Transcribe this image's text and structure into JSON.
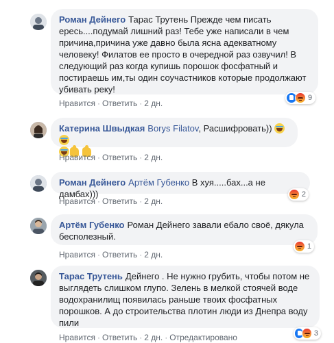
{
  "colors": {
    "bubble_bg": "#f2f3f5",
    "author": "#385898",
    "meta": "#606770",
    "like": "#1877f2",
    "angry": "#e9332b"
  },
  "comments": [
    {
      "author": "Роман Дейнего",
      "body_lines": [
        "Тарас Трутень Прежде чем писать",
        "ересь....подумай лишний раз! Тебе уже написали в чем",
        "причина,причина уже давно была ясна адекватному",
        "человеку! Филатов ее просто в очередной раз озвучил! В",
        "следующий раз когда купишь порошок фосфатный и",
        "постираешь им,ты один соучастников которые продолжают",
        "убивать реку!"
      ],
      "like_label": "Нравится",
      "reply_label": "Ответить",
      "time": "2 дн.",
      "reactions": [
        "like-icon",
        "angry-icon"
      ],
      "reaction_count": "9"
    },
    {
      "author": "Катерина Швыдкая",
      "mention": "Borys Filatov",
      "text": ", Расшифровать))",
      "emoji_line1": [
        "laughing-emoji",
        "laughing-emoji"
      ],
      "emoji_line2": [
        "laughing-emoji",
        "thumbs-up-emoji",
        "thumbs-up-emoji"
      ],
      "like_label": "Нравится",
      "reply_label": "Ответить",
      "time": "2 дн."
    },
    {
      "author": "Роман Дейнего",
      "mention": "Артём Губенко",
      "text": "В хуя.....бах...а не дамбах)))",
      "like_label": "Нравится",
      "reply_label": "Ответить",
      "time": "2 дн.",
      "reactions": [
        "angry-icon"
      ],
      "reaction_count": "2"
    },
    {
      "author": "Артём Губенко",
      "body_lines": [
        "Роман Дейнего завали ебало своё, дякула",
        "бесполезный."
      ],
      "like_label": "Нравится",
      "reply_label": "Ответить",
      "time": "2 дн.",
      "reactions": [
        "angry-icon"
      ],
      "reaction_count": "1"
    },
    {
      "author": "Тарас Трутень",
      "body_lines": [
        "Дейнего . Не нужно грубить, чтобы потом не",
        "выглядеть слишком глупо. Зелень в мелкой стоячей воде",
        "водохранилищ появилась раньше твоих фосфатных",
        "порошков. А до строительства плотин люди из Днепра воду",
        "пили"
      ],
      "like_label": "Нравится",
      "reply_label": "Ответить",
      "time": "2 дн.",
      "edited": "Отредактировано",
      "reactions": [
        "like-icon",
        "angry-icon"
      ],
      "reaction_count": "3"
    }
  ]
}
